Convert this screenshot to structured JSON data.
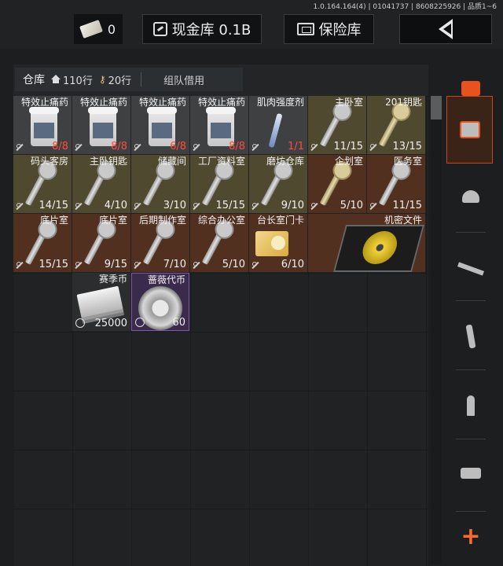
{
  "version": "1.0.164.164(4) | 01041737 | 8608225926 | 品质1~6",
  "topbar": {
    "money_value": "0",
    "cash_label": "现金库 0.1B",
    "safe_label": "保险库",
    "back_icon": "chevron-left-icon"
  },
  "warehouse": {
    "tab_label": "仓库",
    "rows_label": "110行",
    "keys_label": "20行",
    "borrow_label": "组队借用"
  },
  "items": [
    {
      "name": "特效止痛药",
      "count": "8/8",
      "count_color": "red",
      "bg": "gray",
      "art": "jar",
      "col": 0,
      "row": 0
    },
    {
      "name": "特效止痛药",
      "count": "8/8",
      "count_color": "red",
      "bg": "gray",
      "art": "jar",
      "col": 1,
      "row": 0
    },
    {
      "name": "特效止痛药",
      "count": "6/8",
      "count_color": "red",
      "bg": "gray",
      "art": "jar",
      "col": 2,
      "row": 0
    },
    {
      "name": "特效止痛药",
      "count": "8/8",
      "count_color": "red",
      "bg": "gray",
      "art": "jar",
      "col": 3,
      "row": 0
    },
    {
      "name": "肌肉强度剂",
      "count": "1/1",
      "count_color": "red",
      "bg": "gray",
      "art": "syringe",
      "col": 4,
      "row": 0
    },
    {
      "name": "主卧室",
      "count": "11/15",
      "count_color": "white",
      "bg": "olive",
      "art": "key",
      "col": 5,
      "row": 0
    },
    {
      "name": "201钥匙",
      "count": "13/15",
      "count_color": "white",
      "bg": "olive",
      "art": "key-gold",
      "col": 6,
      "row": 0
    },
    {
      "name": "码头客房",
      "count": "14/15",
      "count_color": "white",
      "bg": "olive",
      "art": "key",
      "col": 0,
      "row": 1
    },
    {
      "name": "主卧钥匙",
      "count": "4/10",
      "count_color": "white",
      "bg": "olive",
      "art": "key",
      "col": 1,
      "row": 1
    },
    {
      "name": "储藏间",
      "count": "3/10",
      "count_color": "white",
      "bg": "olive",
      "art": "key",
      "col": 2,
      "row": 1
    },
    {
      "name": "工厂资料室",
      "count": "15/15",
      "count_color": "white",
      "bg": "olive",
      "art": "key",
      "col": 3,
      "row": 1
    },
    {
      "name": "磨坊仓库",
      "count": "9/10",
      "count_color": "white",
      "bg": "olive",
      "art": "key",
      "col": 4,
      "row": 1
    },
    {
      "name": "企划室",
      "count": "5/10",
      "count_color": "white",
      "bg": "brown",
      "art": "key-gold",
      "col": 5,
      "row": 1
    },
    {
      "name": "医务室",
      "count": "11/15",
      "count_color": "white",
      "bg": "brown",
      "art": "key",
      "col": 6,
      "row": 1
    },
    {
      "name": "底片室",
      "count": "15/15",
      "count_color": "white",
      "bg": "brown",
      "art": "key",
      "col": 0,
      "row": 2
    },
    {
      "name": "底片室",
      "count": "9/15",
      "count_color": "white",
      "bg": "brown",
      "art": "key",
      "col": 1,
      "row": 2
    },
    {
      "name": "后期制作室",
      "count": "7/10",
      "count_color": "white",
      "bg": "brown",
      "art": "key",
      "col": 2,
      "row": 2
    },
    {
      "name": "综合办公室",
      "count": "5/10",
      "count_color": "white",
      "bg": "brown",
      "art": "key",
      "col": 3,
      "row": 2
    },
    {
      "name": "台长室门卡",
      "count": "6/10",
      "count_color": "white",
      "bg": "brown",
      "art": "card",
      "col": 4,
      "row": 2
    },
    {
      "name": "机密文件",
      "count": "",
      "count_color": "white",
      "bg": "brown",
      "art": "disc",
      "col": 5,
      "row": 2,
      "wide": true
    },
    {
      "name": "赛季币",
      "count": "25000",
      "count_color": "white",
      "bg": "dark",
      "art": "cash",
      "col": 1,
      "row": 3
    },
    {
      "name": "蔷薇代币",
      "count": "60",
      "count_color": "white",
      "bg": "purple",
      "art": "coin",
      "col": 2,
      "row": 3
    }
  ],
  "rail": {
    "icons": [
      "layers-refresh-icon",
      "sort-icon",
      "helmet-icon",
      "rifle-icon",
      "magazine-icon",
      "ammo-icon",
      "scope-icon"
    ],
    "plus_label": "+"
  }
}
